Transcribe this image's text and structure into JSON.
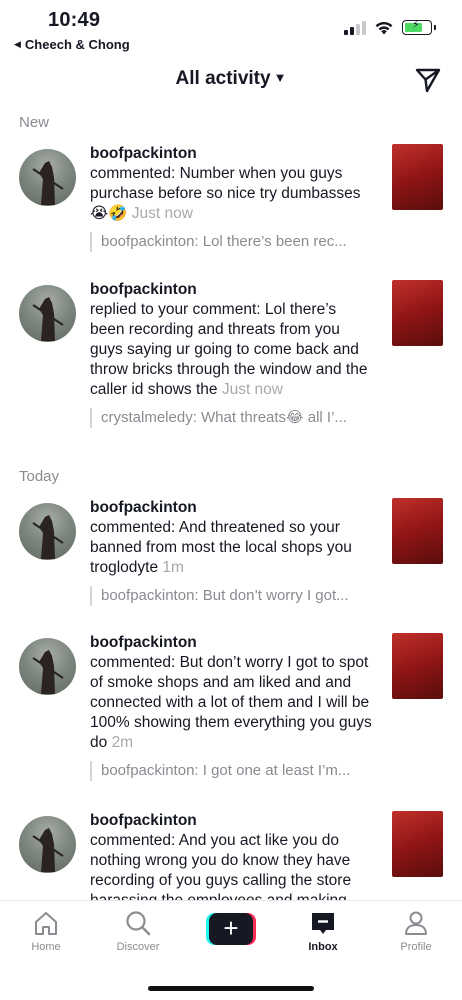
{
  "status_bar": {
    "time": "10:49",
    "back_app": "Cheech & Chong",
    "back_icon": "left-triangle-icon"
  },
  "header": {
    "title": "All activity",
    "dropdown_icon": "chevron-down-icon",
    "dm_icon": "paper-plane-icon"
  },
  "sections": [
    {
      "label": "New",
      "items": [
        {
          "username": "boofpackinton",
          "text": "commented: Number when you guys purchase before so nice try dumbasses 😭🤣",
          "ago": "Just now",
          "preview": "boofpackinton: Lol there’s been rec..."
        },
        {
          "username": "boofpackinton",
          "text": "replied to your comment: Lol there’s been recording and threats from you guys saying ur going to come back and throw bricks through the window and the caller id shows the",
          "ago": "Just now",
          "preview": "crystalmeledy: What threats😂 all I’..."
        }
      ]
    },
    {
      "label": "Today",
      "items": [
        {
          "username": "boofpackinton",
          "text": "commented: And threatened so your banned from most the local shops you troglodyte",
          "ago": "1m",
          "preview": "boofpackinton: But don’t worry I got..."
        },
        {
          "username": "boofpackinton",
          "text": "commented: But don’t worry I got to spot of smoke shops and am liked and and connected with a lot of them and I will be 100% showing them everything you guys do",
          "ago": "2m",
          "preview": "boofpackinton: I got one at least I’m..."
        },
        {
          "username": "boofpackinton",
          "text": "commented: And you act like you do nothing wrong you do know they have recording of you guys calling the store harassing the employees and making",
          "ago": "",
          "preview": ""
        }
      ]
    }
  ],
  "bottom_nav": {
    "home": "Home",
    "discover": "Discover",
    "create_icon": "plus-icon",
    "inbox": "Inbox",
    "profile": "Profile",
    "active": "inbox"
  },
  "colors": {
    "accent_cyan": "#25f4ee",
    "accent_red": "#fe2c55",
    "text": "#161823",
    "muted": "#8a8b91"
  }
}
